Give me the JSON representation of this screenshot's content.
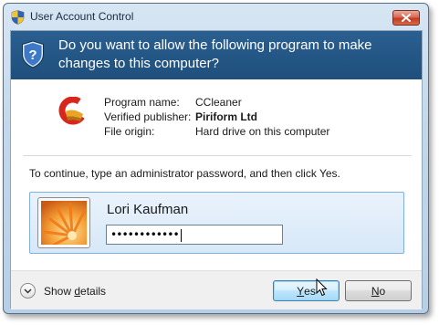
{
  "window": {
    "title": "User Account Control",
    "title_icon": "uac-shield-icon",
    "close_icon": "close-icon"
  },
  "header": {
    "question": "Do you want to allow the following program to make changes to this computer?",
    "icon": "uac-shield-icon"
  },
  "program": {
    "icon": "ccleaner-icon",
    "rows": [
      {
        "label": "Program name:",
        "value": "CCleaner",
        "bold": false
      },
      {
        "label": "Verified publisher:",
        "value": "Piriform Ltd",
        "bold": true
      },
      {
        "label": "File origin:",
        "value": "Hard drive on this computer",
        "bold": false
      }
    ]
  },
  "instruction": "To continue, type an administrator password, and then click Yes.",
  "credentials": {
    "avatar": "flower-avatar",
    "username": "Lori Kaufman",
    "password_mask": "••••••••••••"
  },
  "footer": {
    "details_label_prefix": "Show ",
    "details_label_accel": "d",
    "details_label_suffix": "etails",
    "yes_accel": "Y",
    "yes_rest": "es",
    "no_accel": "N",
    "no_rest": "o"
  },
  "colors": {
    "header_bg": "#1f4f7c",
    "close_red": "#c13b22",
    "default_button": "#bee6fd"
  }
}
